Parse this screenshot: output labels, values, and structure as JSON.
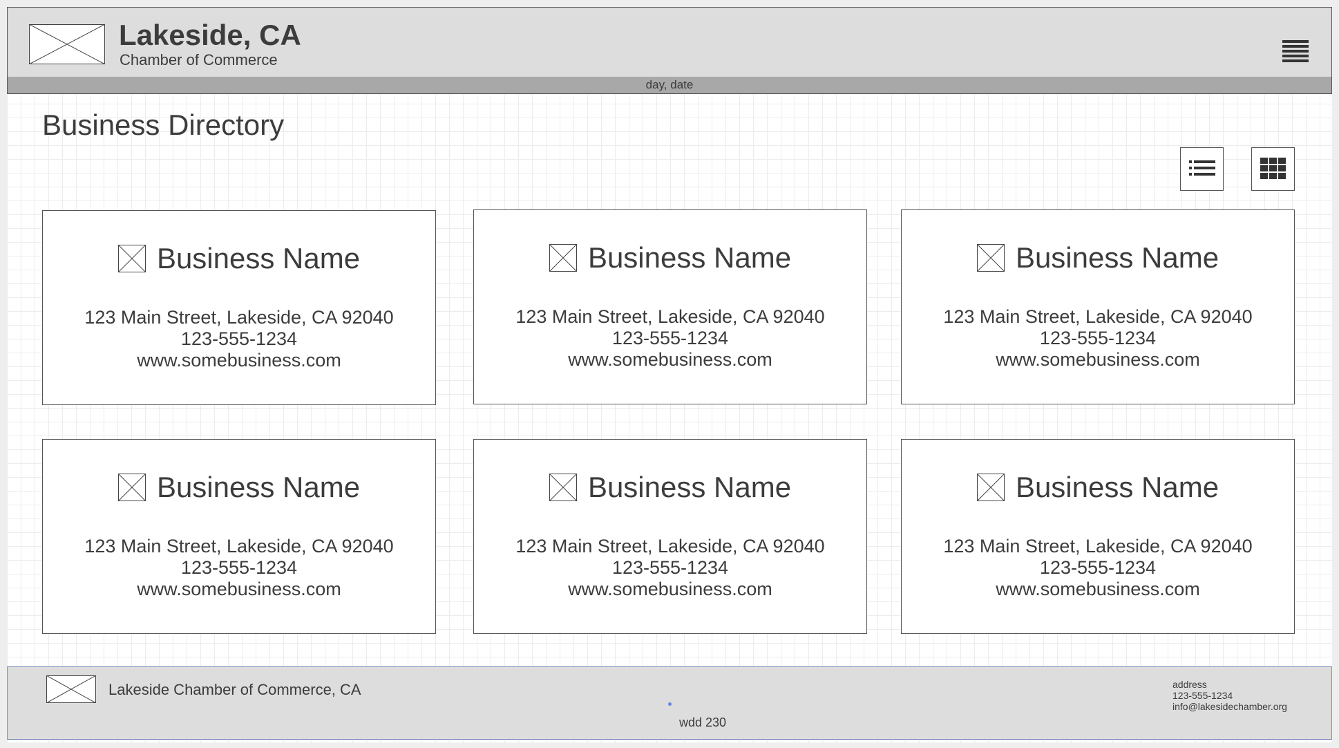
{
  "header": {
    "title": "Lakeside, CA",
    "subtitle": "Chamber of Commerce",
    "logo_icon": "image-placeholder-icon",
    "menu_icon": "hamburger-menu-icon"
  },
  "datebar": {
    "text": "day, date"
  },
  "main": {
    "title": "Business Directory",
    "view_toggle": {
      "list_icon": "list-view-icon",
      "grid_icon": "grid-view-icon"
    },
    "cards": [
      {
        "name": "Business Name",
        "address": "123 Main Street, Lakeside, CA 92040",
        "phone": "123-555-1234",
        "website": "www.somebusiness.com"
      },
      {
        "name": "Business Name",
        "address": "123 Main Street, Lakeside, CA 92040",
        "phone": "123-555-1234",
        "website": "www.somebusiness.com"
      },
      {
        "name": "Business Name",
        "address": "123 Main Street, Lakeside, CA 92040",
        "phone": "123-555-1234",
        "website": "www.somebusiness.com"
      },
      {
        "name": "Business Name",
        "address": "123 Main Street, Lakeside, CA 92040",
        "phone": "123-555-1234",
        "website": "www.somebusiness.com"
      },
      {
        "name": "Business Name",
        "address": "123 Main Street, Lakeside, CA 92040",
        "phone": "123-555-1234",
        "website": "www.somebusiness.com"
      },
      {
        "name": "Business Name",
        "address": "123 Main Street, Lakeside, CA 92040",
        "phone": "123-555-1234",
        "website": "www.somebusiness.com"
      }
    ]
  },
  "footer": {
    "name": "Lakeside Chamber of Commerce, CA",
    "tag": "wdd 230",
    "contact": {
      "address": "address",
      "phone": "123-555-1234",
      "email": "info@lakesidechamber.org"
    }
  },
  "colors": {
    "header_bg": "#dddddd",
    "datebar_bg": "#a8a8a8",
    "footer_border": "#7d8fc0",
    "text": "#3c3c3c"
  }
}
